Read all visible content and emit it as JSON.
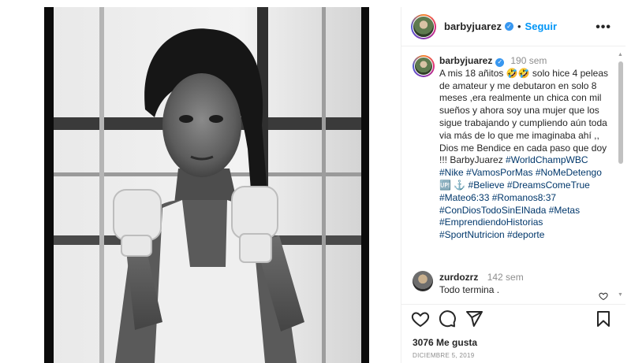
{
  "post": {
    "username": "barbyjuarez",
    "follow_label": "Seguir",
    "separator": "•",
    "more_label": "•••"
  },
  "caption": {
    "username": "barbyjuarez",
    "time": "190 sem",
    "text_part1": "A mis 18 añitos 🤣🤣 solo hice 4 peleas de amateur y me debutaron en solo 8 meses ,era realmente un chica con mil sueños y ahora soy una mujer que los sigue trabajando y cumpliendo aún toda via más de lo que me imaginaba ahí ,, Dios me Bendice en cada paso que doy !!! BarbyJuarez ",
    "hashtags": "#WorldChampWBC #Nike #VamosPorMas #NoMeDetengo 🆙 ⚓ #Believe #DreamsComeTrue #Mateo6:33 #Romanos8:37 #ConDiosTodoSinElNada #Metas #EmprendiendoHistorias #SportNutricion #deporte"
  },
  "comment": {
    "username": "zurdozrz",
    "time": "142 sem",
    "text": "Todo termina ."
  },
  "engagement": {
    "likes": "3076 Me gusta",
    "date": "DICIEMBRE 5, 2019"
  },
  "scrollbar": {
    "up": "▲",
    "down": "▼"
  },
  "icons": [
    "heart-icon",
    "comment-icon",
    "share-icon",
    "bookmark-icon",
    "verified-icon",
    "more-icon"
  ],
  "colors": {
    "link": "#0095f6",
    "hashtag": "#00376b",
    "muted": "#8e8e8e",
    "verified": "#3897f0"
  }
}
